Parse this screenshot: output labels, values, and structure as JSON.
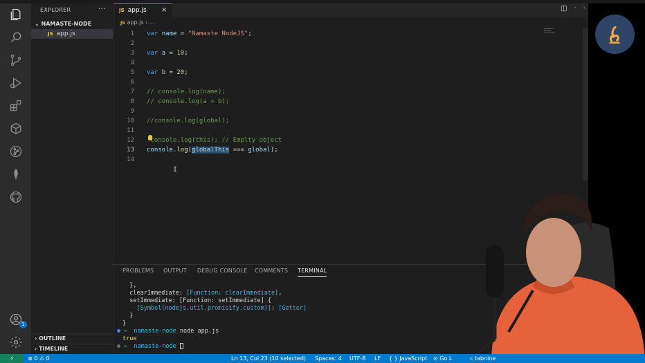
{
  "sidebar": {
    "title": "EXPLORER",
    "more": "···",
    "folder": "NAMASTE-NODE",
    "file": {
      "tag": "JS",
      "name": "app.js"
    },
    "outline": "OUTLINE",
    "timeline": "TIMELINE"
  },
  "activity": {
    "icons": [
      "files-icon",
      "search-icon",
      "source-control-icon",
      "run-debug-icon",
      "extensions-icon",
      "docker-icon",
      "git-graph-icon",
      "mongodb-leaf-icon",
      "github-icon",
      "account-icon",
      "settings-gear-icon"
    ],
    "account_badge": "1"
  },
  "editor": {
    "tab": {
      "tag": "JS",
      "label": "app.js",
      "close": "×"
    },
    "breadcrumb": {
      "tag": "JS",
      "file": "app.js",
      "sep": "›",
      "rest": "..."
    },
    "lines": [
      {
        "n": "1",
        "parts": [
          [
            "kw",
            "var"
          ],
          [
            "plain",
            " "
          ],
          [
            "var",
            "name"
          ],
          [
            "plain",
            " = "
          ],
          [
            "str",
            "\"Namaste NodeJS\""
          ],
          [
            "plain",
            ";"
          ]
        ]
      },
      {
        "n": "2",
        "parts": []
      },
      {
        "n": "3",
        "parts": [
          [
            "kw",
            "var"
          ],
          [
            "plain",
            " "
          ],
          [
            "var",
            "a"
          ],
          [
            "plain",
            " = "
          ],
          [
            "num",
            "10"
          ],
          [
            "plain",
            ";"
          ]
        ]
      },
      {
        "n": "4",
        "parts": []
      },
      {
        "n": "5",
        "parts": [
          [
            "kw",
            "var"
          ],
          [
            "plain",
            " "
          ],
          [
            "var",
            "b"
          ],
          [
            "plain",
            " = "
          ],
          [
            "num",
            "20"
          ],
          [
            "plain",
            ";"
          ]
        ]
      },
      {
        "n": "6",
        "parts": []
      },
      {
        "n": "7",
        "parts": [
          [
            "cmt",
            "// console.log(name);"
          ]
        ]
      },
      {
        "n": "8",
        "parts": [
          [
            "cmt",
            "// console.log(a + b);"
          ]
        ]
      },
      {
        "n": "9",
        "parts": []
      },
      {
        "n": "10",
        "parts": [
          [
            "cmt",
            "//console.log(global);"
          ]
        ]
      },
      {
        "n": "11",
        "parts": []
      },
      {
        "n": "12",
        "parts": [
          [
            "cmt",
            " console.log(this); // Emplty object"
          ]
        ]
      },
      {
        "n": "13",
        "parts": [
          [
            "var",
            "console"
          ],
          [
            "plain",
            "."
          ],
          [
            "fn",
            "log"
          ],
          [
            "plain",
            "("
          ],
          [
            "sel",
            "globalThis"
          ],
          [
            "plain",
            " === "
          ],
          [
            "var",
            "global"
          ],
          [
            "plain",
            ");"
          ]
        ]
      },
      {
        "n": "14",
        "parts": []
      }
    ],
    "current_line": "13"
  },
  "panel": {
    "tabs": [
      "PROBLEMS",
      "OUTPUT",
      "DEBUG CONSOLE",
      "COMMENTS",
      "TERMINAL"
    ],
    "active_tab": "TERMINAL",
    "terminal": [
      {
        "parts": [
          [
            "plain",
            "  },"
          ]
        ]
      },
      {
        "parts": [
          [
            "plain",
            "  clearImmediate: "
          ],
          [
            "t-cyan",
            "[Function: clearImmediate]"
          ],
          [
            "plain",
            ","
          ]
        ]
      },
      {
        "parts": [
          [
            "plain",
            "  setImmediate: [Function: setImmediate] {"
          ]
        ]
      },
      {
        "parts": [
          [
            "plain",
            "    "
          ],
          [
            "t-cyan",
            "[Symbol(nodejs.util.promisify.custom)]"
          ],
          [
            "plain",
            ": "
          ],
          [
            "t-cyan",
            "[Getter]"
          ]
        ]
      },
      {
        "parts": [
          [
            "plain",
            "  }"
          ]
        ]
      },
      {
        "parts": [
          [
            "plain",
            "}"
          ]
        ]
      },
      {
        "dot": "blue",
        "parts": [
          [
            "t-green",
            "→"
          ],
          [
            "plain",
            "  "
          ],
          [
            "t-cyan",
            "namaste-node"
          ],
          [
            "plain",
            " node app.js"
          ]
        ]
      },
      {
        "parts": [
          [
            "t-yellow",
            "true"
          ]
        ]
      },
      {
        "dot": "gray",
        "parts": [
          [
            "t-green",
            "→"
          ],
          [
            "plain",
            "  "
          ],
          [
            "t-cyan",
            "namaste-node"
          ],
          [
            "plain",
            " "
          ]
        ],
        "cursor": true
      }
    ]
  },
  "status": {
    "remote": "⚡",
    "problems": "⊗ 0 ⚠ 0",
    "position": "Ln 13, Col 23 (10 selected)",
    "spaces": "Spaces: 4",
    "encoding": "UTF-8",
    "eol": "LF",
    "language": "{ } JavaScript",
    "golive": "⊙ Go L",
    "tabnine": "c tabnine"
  }
}
